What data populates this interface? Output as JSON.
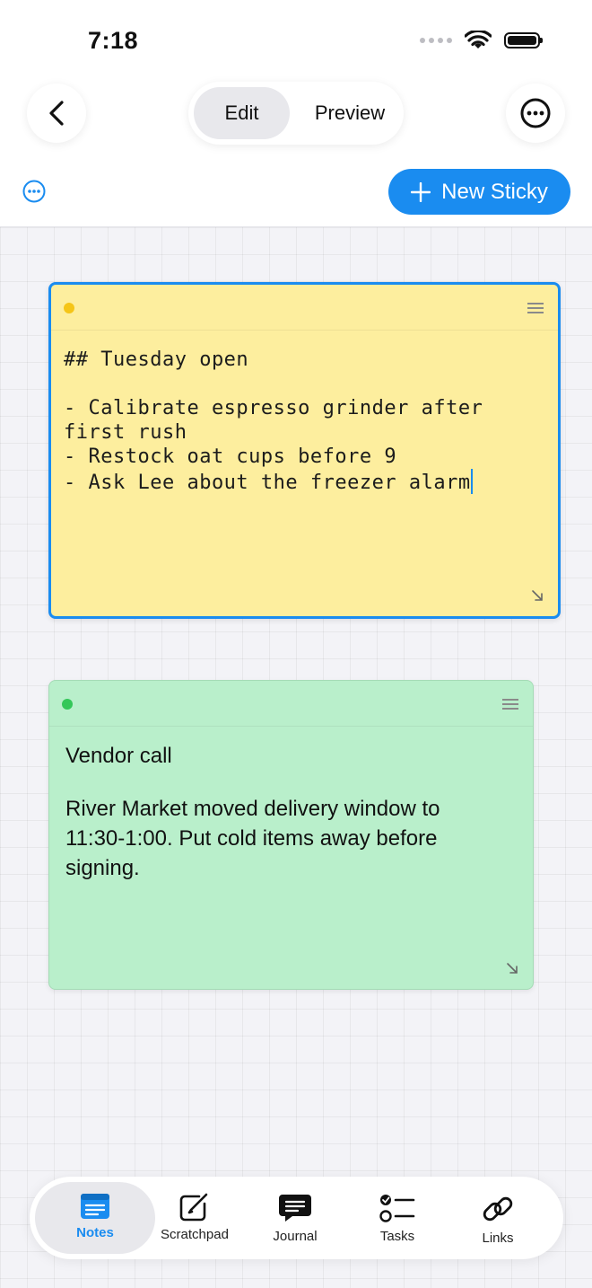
{
  "status_bar": {
    "time": "7:18"
  },
  "header": {
    "segments": [
      "Edit",
      "Preview"
    ],
    "selected_segment": "Edit",
    "new_sticky_label": "New Sticky"
  },
  "stickies": [
    {
      "color": "#fdee9e",
      "dot_color": "#f5c518",
      "selected": true,
      "lines": [
        "## Tuesday open",
        "",
        "- Calibrate espresso grinder after",
        "first rush",
        "- Restock oat cups before 9",
        "- Ask Lee about the freezer alarm"
      ]
    },
    {
      "color": "#b9efcb",
      "dot_color": "#34c759",
      "selected": false,
      "title": "Vendor call",
      "body": "River Market moved delivery window to 11:30-1:00. Put cold items away before signing."
    }
  ],
  "tabs": [
    {
      "label": "Notes",
      "icon": "notes-icon",
      "active": true
    },
    {
      "label": "Scratchpad",
      "icon": "scratchpad-icon",
      "active": false
    },
    {
      "label": "Journal",
      "icon": "journal-icon",
      "active": false
    },
    {
      "label": "Tasks",
      "icon": "tasks-icon",
      "active": false
    },
    {
      "label": "Links",
      "icon": "links-icon",
      "active": false
    }
  ],
  "colors": {
    "accent": "#1a8cf0"
  }
}
